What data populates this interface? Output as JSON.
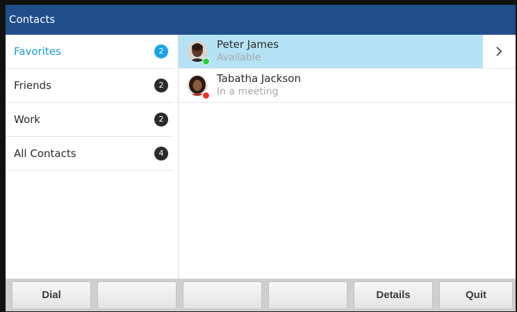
{
  "header": {
    "title": "Contacts"
  },
  "sidebar": {
    "items": [
      {
        "label": "Favorites",
        "count": "2",
        "active": true
      },
      {
        "label": "Friends",
        "count": "2",
        "active": false
      },
      {
        "label": "Work",
        "count": "2",
        "active": false
      },
      {
        "label": "All Contacts",
        "count": "4",
        "active": false
      }
    ]
  },
  "contacts": [
    {
      "name": "Peter James",
      "status": "Available",
      "status_color": "#2ecc40",
      "avatar_icon": "person-avatar-icon"
    },
    {
      "name": "Tabatha Jackson",
      "status": "In a meeting",
      "status_color": "#e8322b",
      "avatar_icon": "person-avatar-icon"
    }
  ],
  "softkeys": [
    "Dial",
    "",
    "",
    "",
    "Details",
    "Quit"
  ],
  "colors": {
    "header": "#1f4e8a",
    "accent": "#1a9ad6",
    "selection": "#b5e2f5"
  }
}
